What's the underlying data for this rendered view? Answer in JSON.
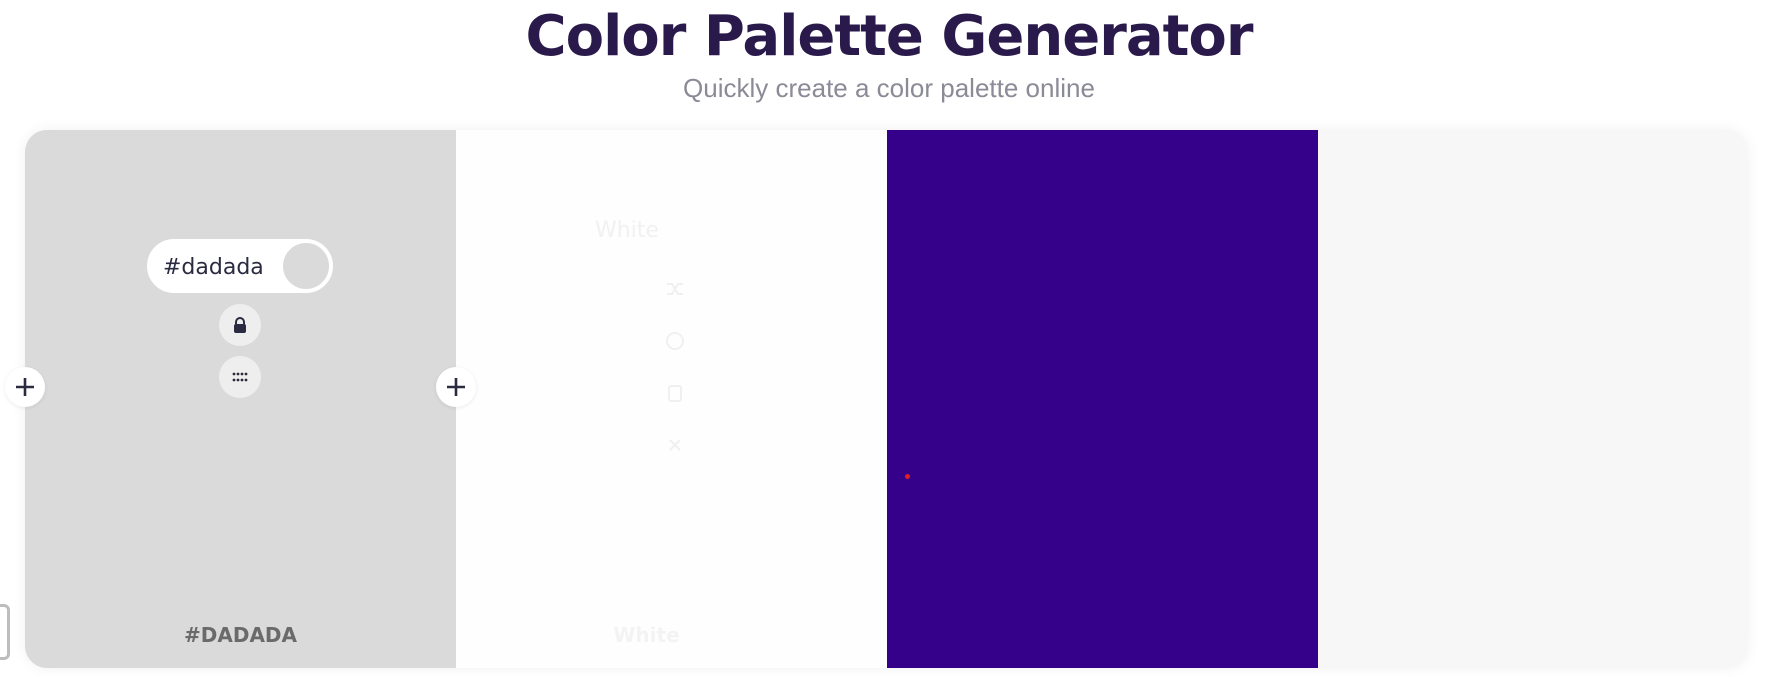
{
  "header": {
    "title": "Color Palette Generator",
    "subtitle": "Quickly create a color palette online"
  },
  "palette": {
    "columns": [
      {
        "hex": "#dadada",
        "label": "#DADADA",
        "input_value": "#dadada"
      },
      {
        "hex": "#fefefe",
        "label": "White",
        "ghost_title": "White"
      },
      {
        "hex": "#35008a"
      },
      {
        "hex": "#f7f7f7"
      }
    ]
  },
  "icons": {
    "lock": "lock-icon",
    "drag": "drag-handle-icon",
    "add": "plus-icon",
    "faded": [
      "shuffle-icon",
      "palette-icon",
      "copy-icon",
      "close-icon"
    ]
  },
  "colors": {
    "title": "#2a1a4b",
    "subtitle": "#8b8a97",
    "accent": "#35008a",
    "marker": "#e02020"
  }
}
